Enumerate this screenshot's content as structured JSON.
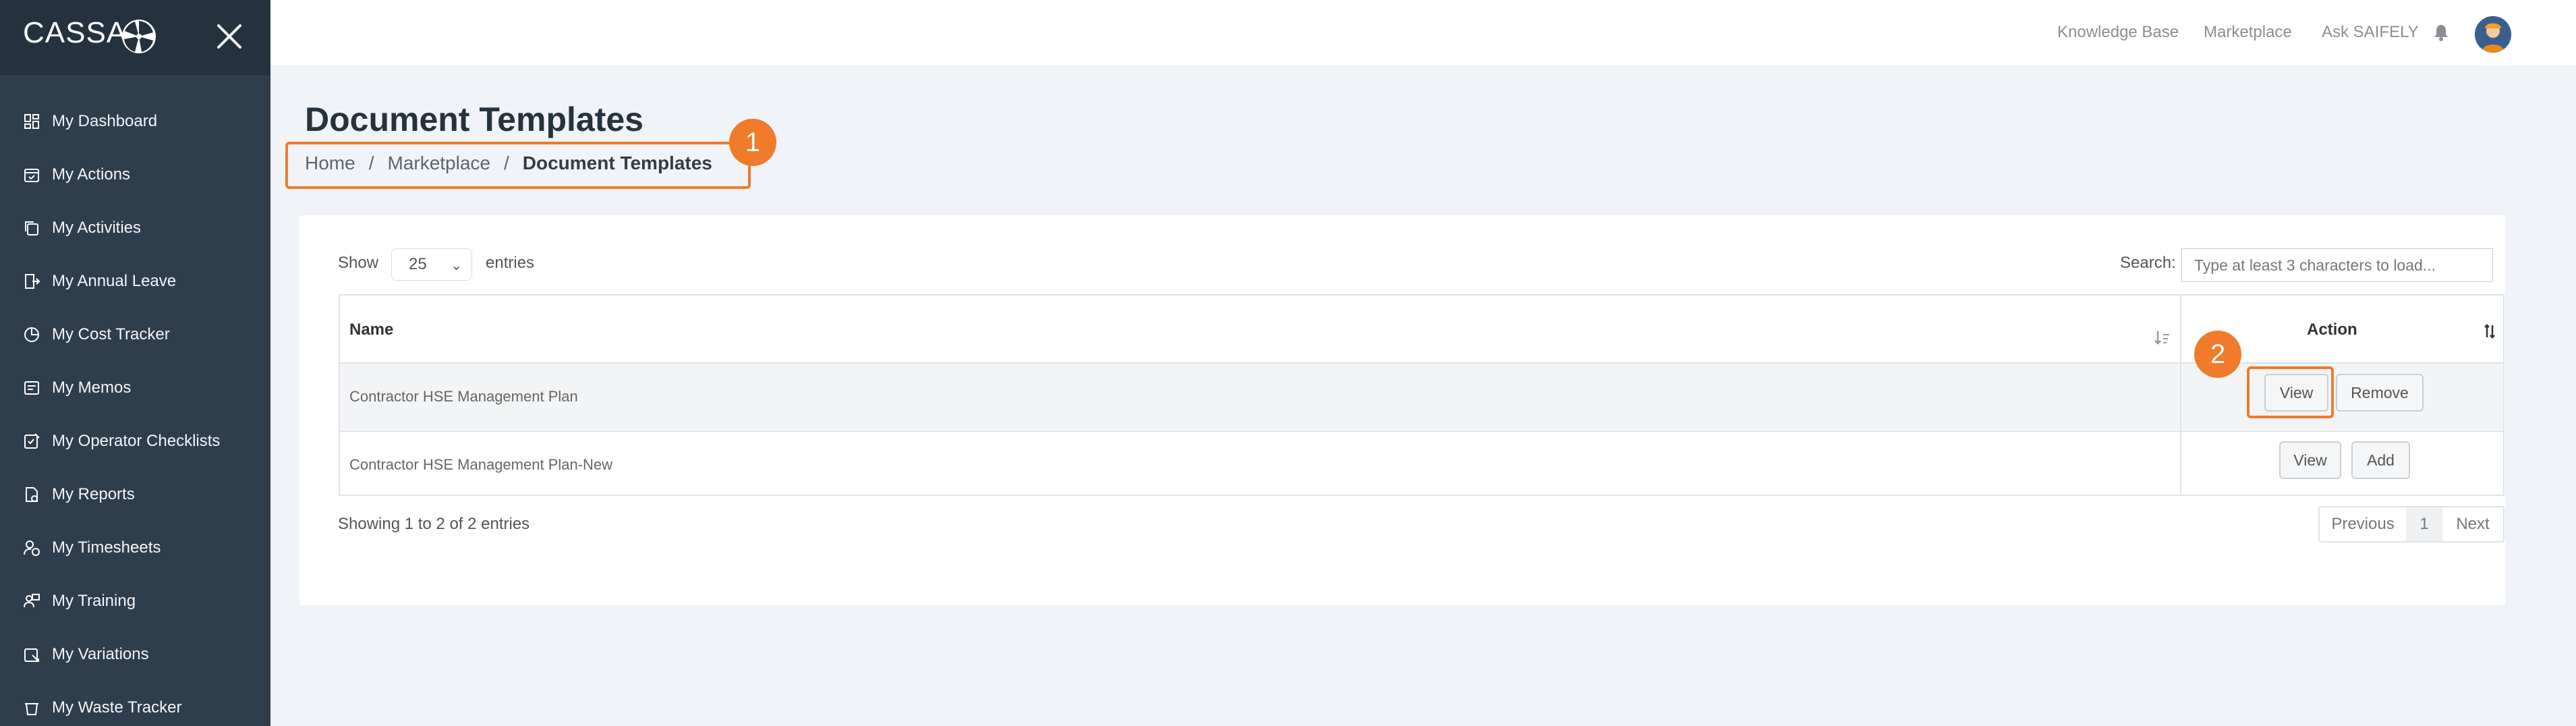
{
  "sidebar": {
    "brand": "CASSA",
    "items": [
      {
        "label": "My Dashboard"
      },
      {
        "label": "My Actions"
      },
      {
        "label": "My Activities"
      },
      {
        "label": "My Annual Leave"
      },
      {
        "label": "My Cost Tracker"
      },
      {
        "label": "My Memos"
      },
      {
        "label": "My Operator Checklists"
      },
      {
        "label": "My Reports"
      },
      {
        "label": "My Timesheets"
      },
      {
        "label": "My Training"
      },
      {
        "label": "My Variations"
      },
      {
        "label": "My Waste Tracker"
      }
    ]
  },
  "topbar": {
    "links": [
      "Knowledge Base",
      "Marketplace",
      "Ask SAIFELY"
    ]
  },
  "page": {
    "title": "Document Templates",
    "breadcrumb": [
      "Home",
      "Marketplace",
      "Document Templates"
    ],
    "separator": "/"
  },
  "annotations": {
    "marker1": "1",
    "marker2": "2",
    "accent_color": "#f07b2a"
  },
  "table_controls": {
    "show_label": "Show",
    "entries_value": "25",
    "entries_label": "entries",
    "search_label": "Search:",
    "search_placeholder": "Type at least 3 characters to load..."
  },
  "table": {
    "headers": {
      "name": "Name",
      "action": "Action"
    },
    "rows": [
      {
        "name": "Contractor HSE Management Plan",
        "buttons": [
          "View",
          "Remove"
        ]
      },
      {
        "name": "Contractor HSE Management Plan-New",
        "buttons": [
          "View",
          "Add"
        ]
      }
    ]
  },
  "footer": {
    "info": "Showing 1 to 2 of 2 entries",
    "pagination": {
      "previous": "Previous",
      "page": "1",
      "next": "Next"
    }
  }
}
